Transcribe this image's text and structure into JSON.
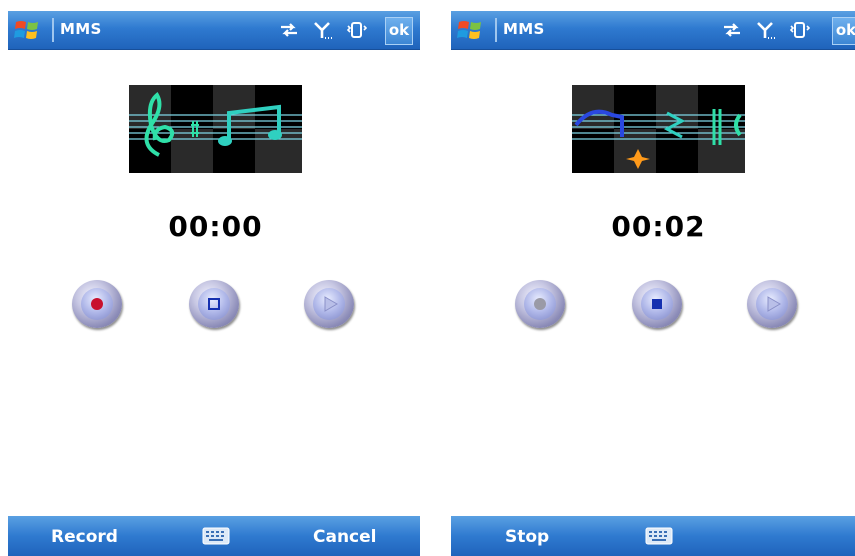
{
  "screens": [
    {
      "app_title": "MMS",
      "ok_label": "ok",
      "timer": "00:00",
      "state": "ready",
      "softkeys": {
        "left": "Record",
        "right": "Cancel"
      }
    },
    {
      "app_title": "MMS",
      "ok_label": "ok",
      "timer": "00:02",
      "state": "recording",
      "softkeys": {
        "left": "Stop",
        "right": ""
      }
    }
  ],
  "icons": {
    "start": "windows-flag-icon",
    "sync": "sync-arrows-icon",
    "signal": "signal-antenna-icon",
    "vibrate": "vibrate-phone-icon",
    "keyboard": "keyboard-icon",
    "record": "record-icon",
    "stop": "stop-icon",
    "play": "play-icon"
  },
  "colors": {
    "titlebar": "#2f7ad0",
    "record_active": "#c8102e",
    "stop_active": "#1530b0",
    "disabled_glyph": "#9a9aa6"
  }
}
